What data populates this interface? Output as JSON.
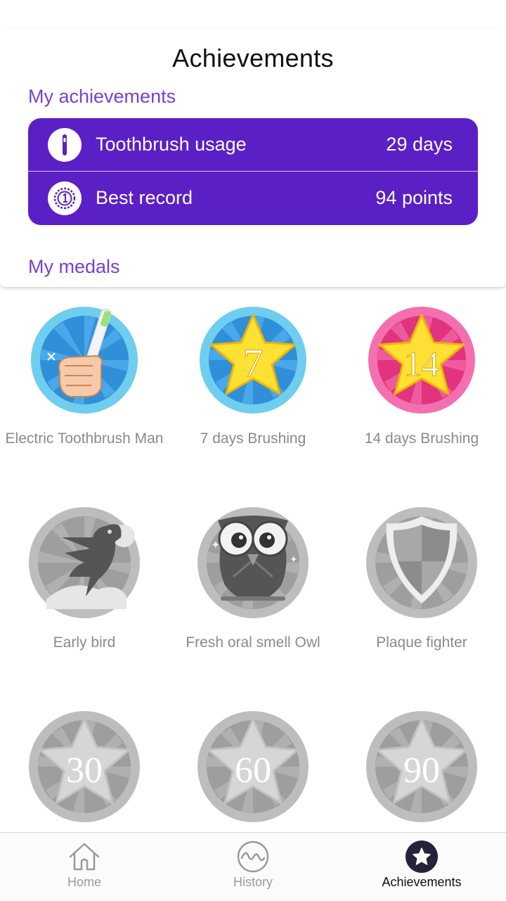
{
  "page": {
    "title": "Achievements"
  },
  "sections": {
    "achievements_label": "My achievements",
    "medals_label": "My medals"
  },
  "stats": [
    {
      "label": "Toothbrush usage",
      "value": "29 days",
      "icon": "toothbrush-icon"
    },
    {
      "label": "Best record",
      "value": "94 points",
      "icon": "rosette-icon"
    }
  ],
  "medals": [
    {
      "name": "Electric Toothbrush Man",
      "icon": "toothbrush-hand-medal",
      "earned": true,
      "number": ""
    },
    {
      "name": "7 days Brushing",
      "icon": "star-medal",
      "earned": true,
      "number": "7"
    },
    {
      "name": "14 days Brushing",
      "icon": "star-medal",
      "earned": true,
      "number": "14"
    },
    {
      "name": "Early bird",
      "icon": "bird-medal",
      "earned": false,
      "number": ""
    },
    {
      "name": "Fresh oral smell Owl",
      "icon": "owl-medal",
      "earned": false,
      "number": ""
    },
    {
      "name": "Plaque fighter",
      "icon": "shield-medal",
      "earned": false,
      "number": ""
    },
    {
      "name": "",
      "icon": "star-medal",
      "earned": false,
      "number": "30"
    },
    {
      "name": "",
      "icon": "star-medal",
      "earned": false,
      "number": "60"
    },
    {
      "name": "",
      "icon": "star-medal",
      "earned": false,
      "number": "90"
    }
  ],
  "tabs": [
    {
      "label": "Home",
      "icon": "home-icon",
      "active": false
    },
    {
      "label": "History",
      "icon": "history-icon",
      "active": false
    },
    {
      "label": "Achievements",
      "icon": "star-icon",
      "active": true
    }
  ],
  "colors": {
    "accent": "#7a3ed4",
    "stats_bg": "#5b1fc6",
    "blue_ring": "#6fcdef",
    "pink_ring": "#f36fb0",
    "star_yellow": "#ffe035",
    "locked_gray": "#c4c4c4"
  }
}
